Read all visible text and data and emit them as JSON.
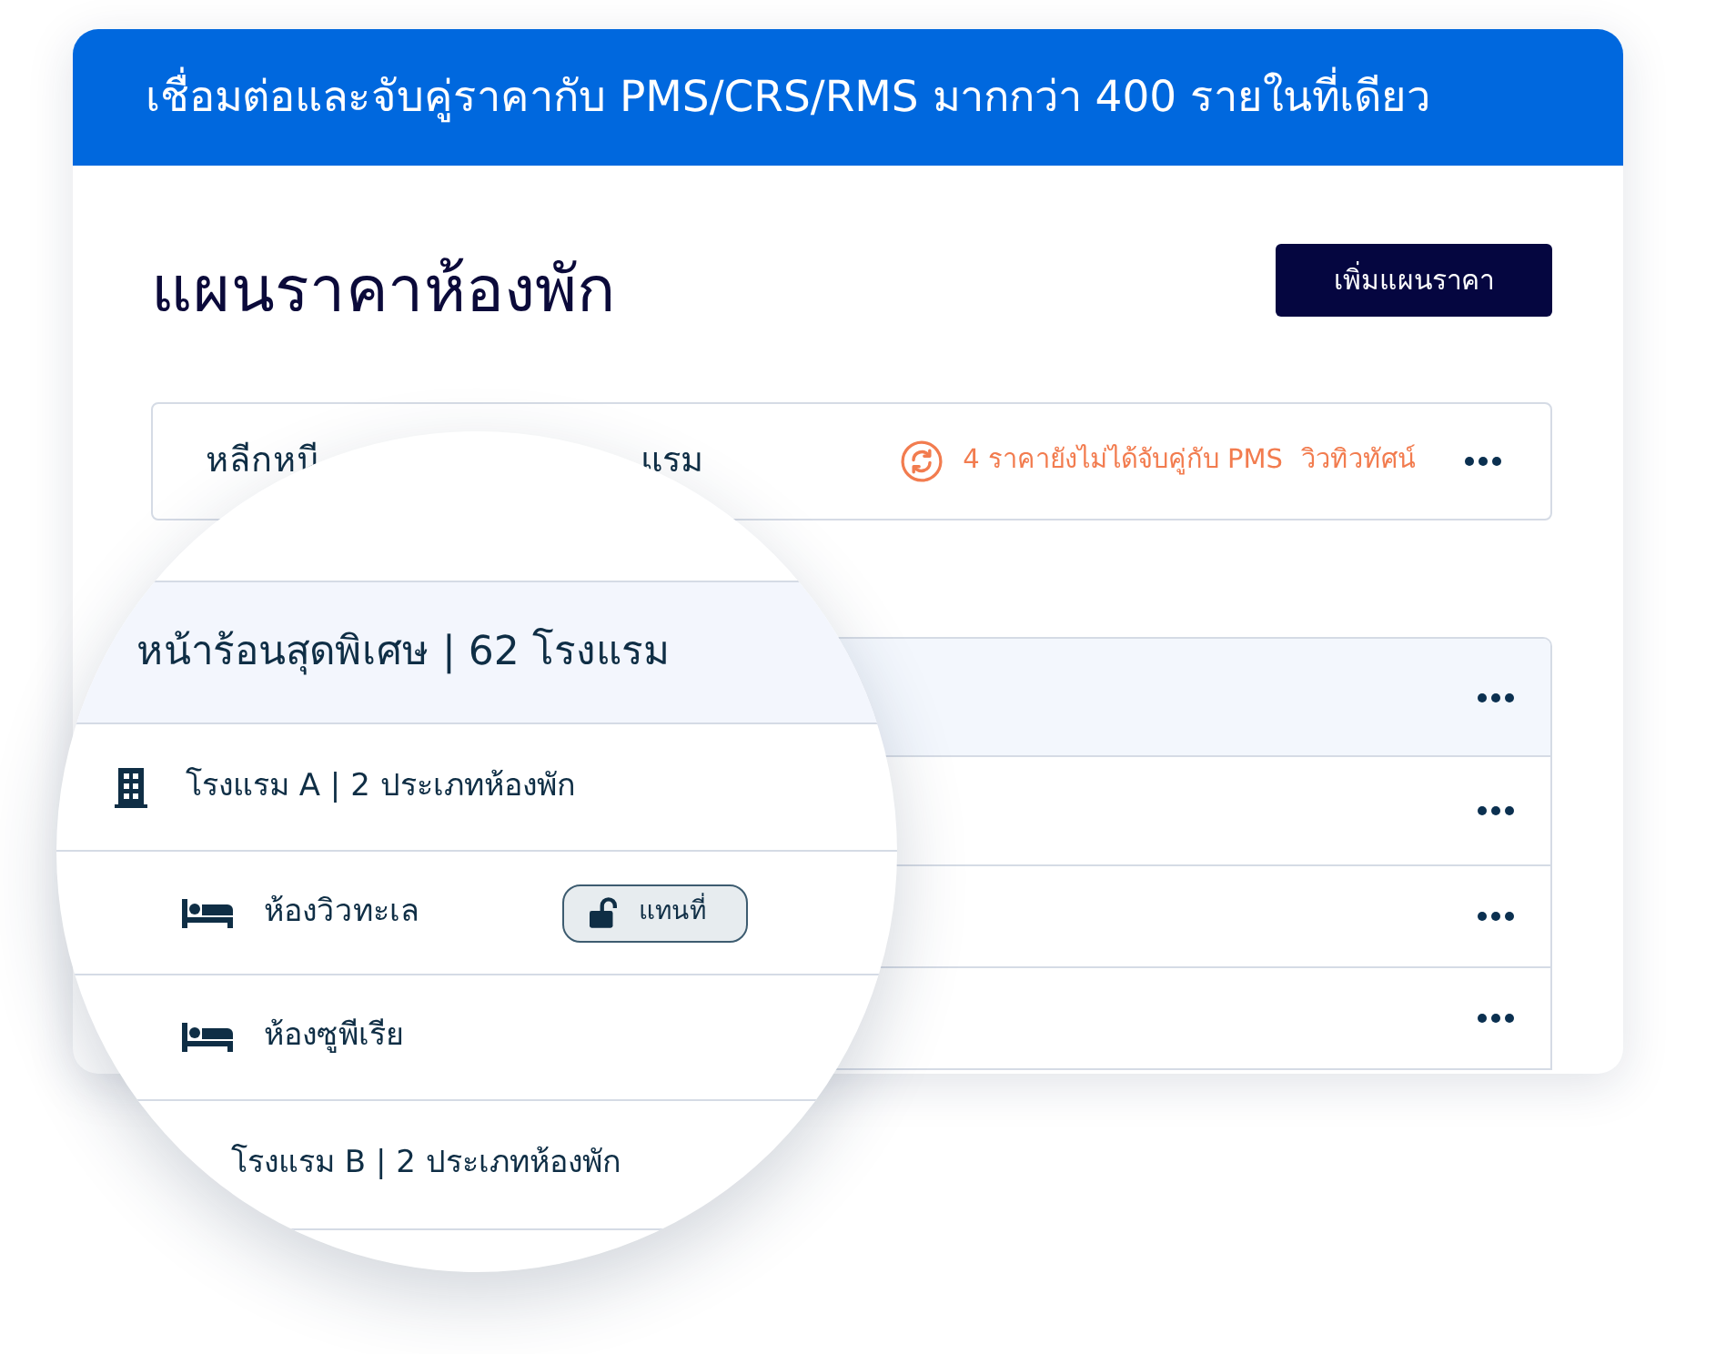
{
  "banner": {
    "text": "เชื่อมต่อและจับคู่ราคากับ PMS/CRS/RMS มากกว่า 400 รายในที่เดียว"
  },
  "header": {
    "title": "แผนราคาห้องพัก",
    "add_button": "เพิ่มแผนราคา"
  },
  "rate_plan": {
    "name_fragments": [
      "หลีกหนี",
      "แรม"
    ],
    "warning": "4 ราคายังไม่ได้จับคู่กับ PMS",
    "link": "วิวทิวทัศน์",
    "menu": true
  },
  "plan_list": {
    "rows": [
      {
        "kind": "group",
        "menu": true
      },
      {
        "kind": "item",
        "menu": true
      },
      {
        "kind": "item",
        "menu": true
      },
      {
        "kind": "item",
        "menu": true
      }
    ]
  },
  "magnifier": {
    "group_title": "หน้าร้อนสุดพิเศษ | 62 โรงแรม",
    "rows": [
      {
        "kind": "hotel",
        "text": "โรงแรม A | 2 ประเภทห้องพัก",
        "show_icon": true
      },
      {
        "kind": "room",
        "text": "ห้องวิวทะเล",
        "badge": {
          "text": "แทนที่",
          "locked": false
        }
      },
      {
        "kind": "room",
        "text": "ห้องซูพีเรีย"
      },
      {
        "kind": "hotel",
        "text": "โรงแรม B | 2 ประเภทห้องพัก",
        "show_icon": false
      }
    ]
  }
}
